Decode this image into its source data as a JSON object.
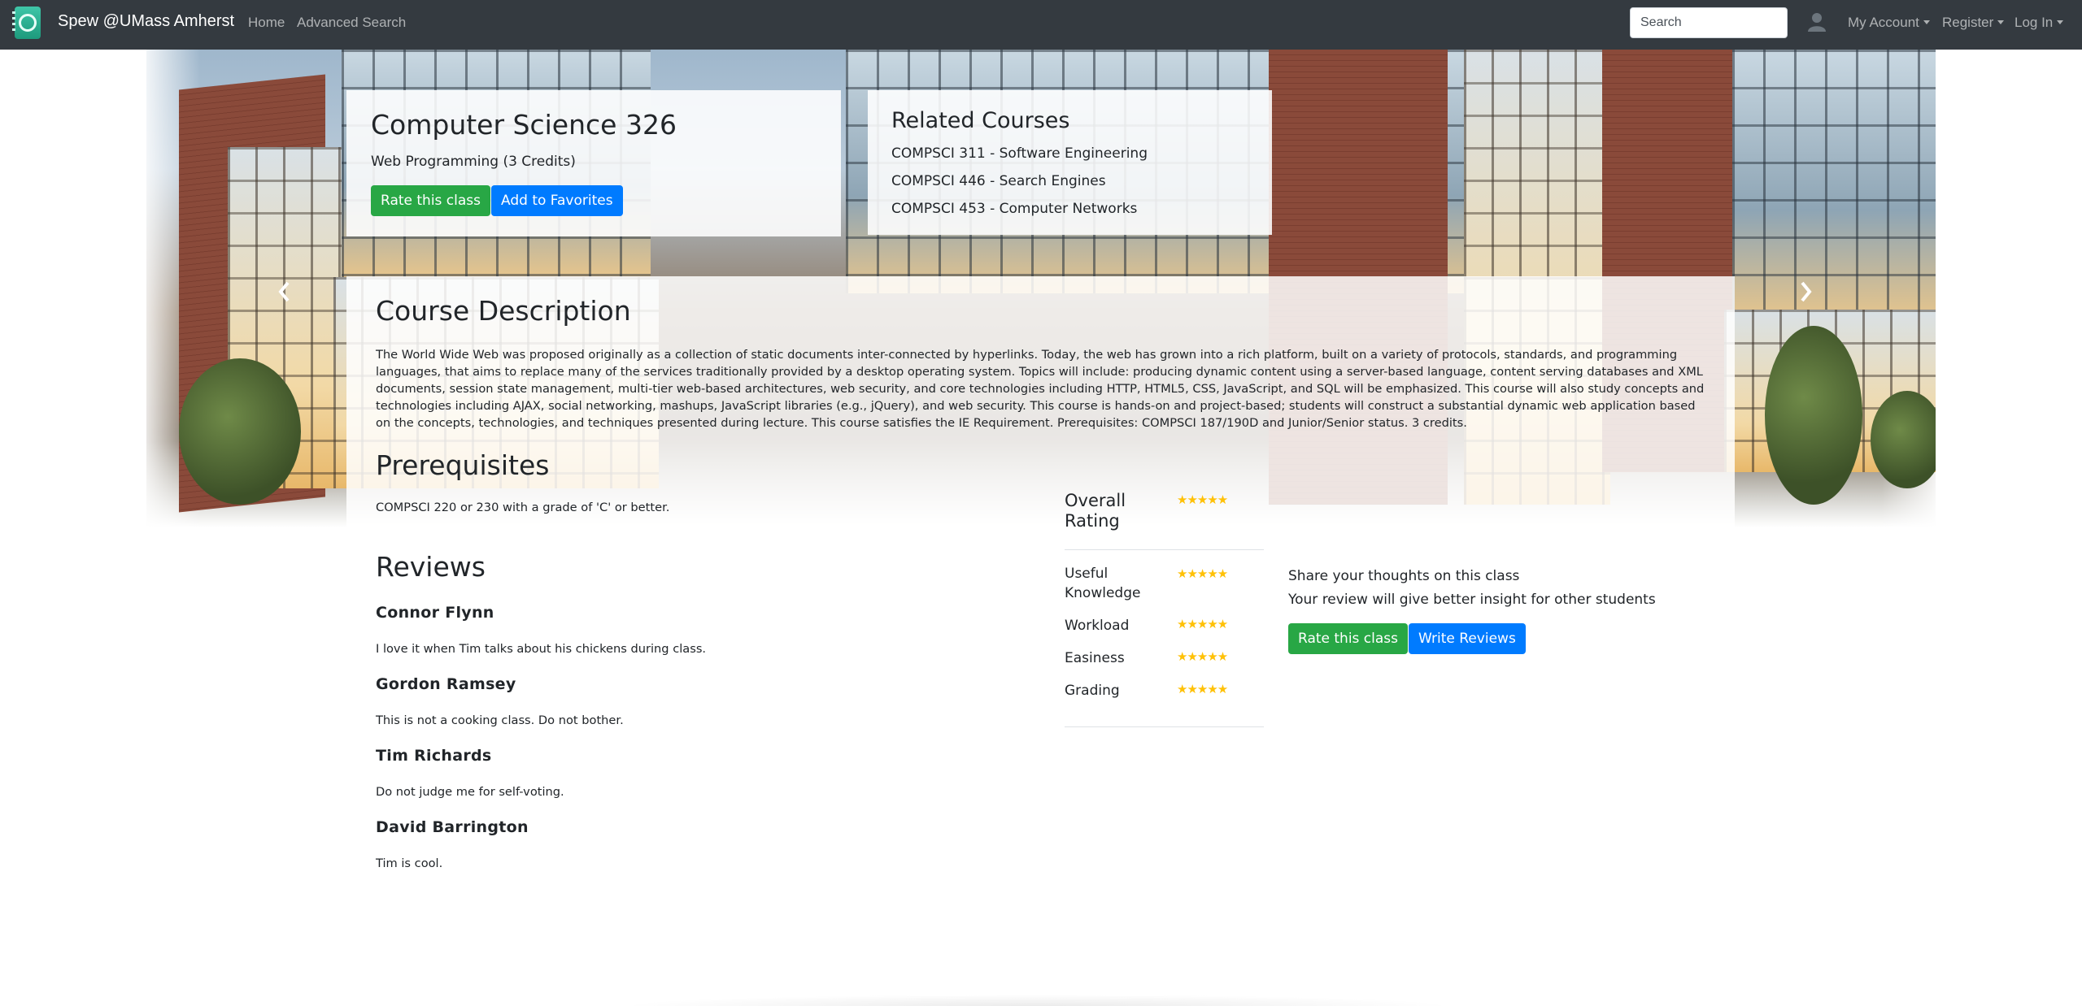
{
  "navbar": {
    "brand": "Spew @UMass Amherst",
    "links": [
      "Home",
      "Advanced Search"
    ],
    "search_placeholder": "Search",
    "dropdowns": [
      "My Account",
      "Register",
      "Log In"
    ]
  },
  "course": {
    "title": "Computer Science 326",
    "subtitle": "Web Programming (3 Credits)",
    "rate_label": "Rate this class",
    "favorite_label": "Add to Favorites"
  },
  "related": {
    "heading": "Related Courses",
    "items": [
      "COMPSCI 311 - Software Engineering",
      "COMPSCI 446 - Search Engines",
      "COMPSCI 453 - Computer Networks"
    ]
  },
  "description": {
    "heading": "Course Description",
    "text": "The World Wide Web was proposed originally as a collection of static documents inter-connected by hyperlinks. Today, the web has grown into a rich platform, built on a variety of protocols, standards, and programming languages, that aims to replace many of the services traditionally provided by a desktop operating system. Topics will include: producing dynamic content using a server-based language, content serving databases and XML documents, session state management, multi-tier web-based architectures, web security, and core technologies including HTTP, HTML5, CSS, JavaScript, and SQL will be emphasized. This course will also study concepts and technologies including AJAX, social networking, mashups, JavaScript libraries (e.g., jQuery), and web security. This course is hands-on and project-based; students will construct a substantial dynamic web application based on the concepts, technologies, and techniques presented during lecture. This course satisfies the IE Requirement. Prerequisites: COMPSCI 187/190D and Junior/Senior status. 3 credits."
  },
  "prerequisites": {
    "heading": "Prerequisites",
    "text": "COMPSCI 220 or 230 with a grade of 'C' or better."
  },
  "reviews": {
    "heading": "Reviews",
    "items": [
      {
        "name": "Connor Flynn",
        "text": "I love it when Tim talks about his chickens during class."
      },
      {
        "name": "Gordon Ramsey",
        "text": "This is not a cooking class. Do not bother."
      },
      {
        "name": "Tim Richards",
        "text": "Do not judge me for self-voting."
      },
      {
        "name": "David Barrington",
        "text": "Tim is cool."
      }
    ]
  },
  "ratings": {
    "overall": {
      "label": "Overall Rating",
      "stars": 5
    },
    "items": [
      {
        "label": "Useful Knowledge",
        "stars": 5
      },
      {
        "label": "Workload",
        "stars": 5
      },
      {
        "label": "Easiness",
        "stars": 5
      },
      {
        "label": "Grading",
        "stars": 5
      }
    ],
    "star_color": "#ffc107"
  },
  "share": {
    "line1": "Share your thoughts on this class",
    "line2": "Your review will give better insight for other students",
    "rate_label": "Rate this class",
    "write_label": "Write Reviews"
  },
  "colors": {
    "navbar": "#343a40",
    "green": "#28a745",
    "blue": "#007bff"
  }
}
